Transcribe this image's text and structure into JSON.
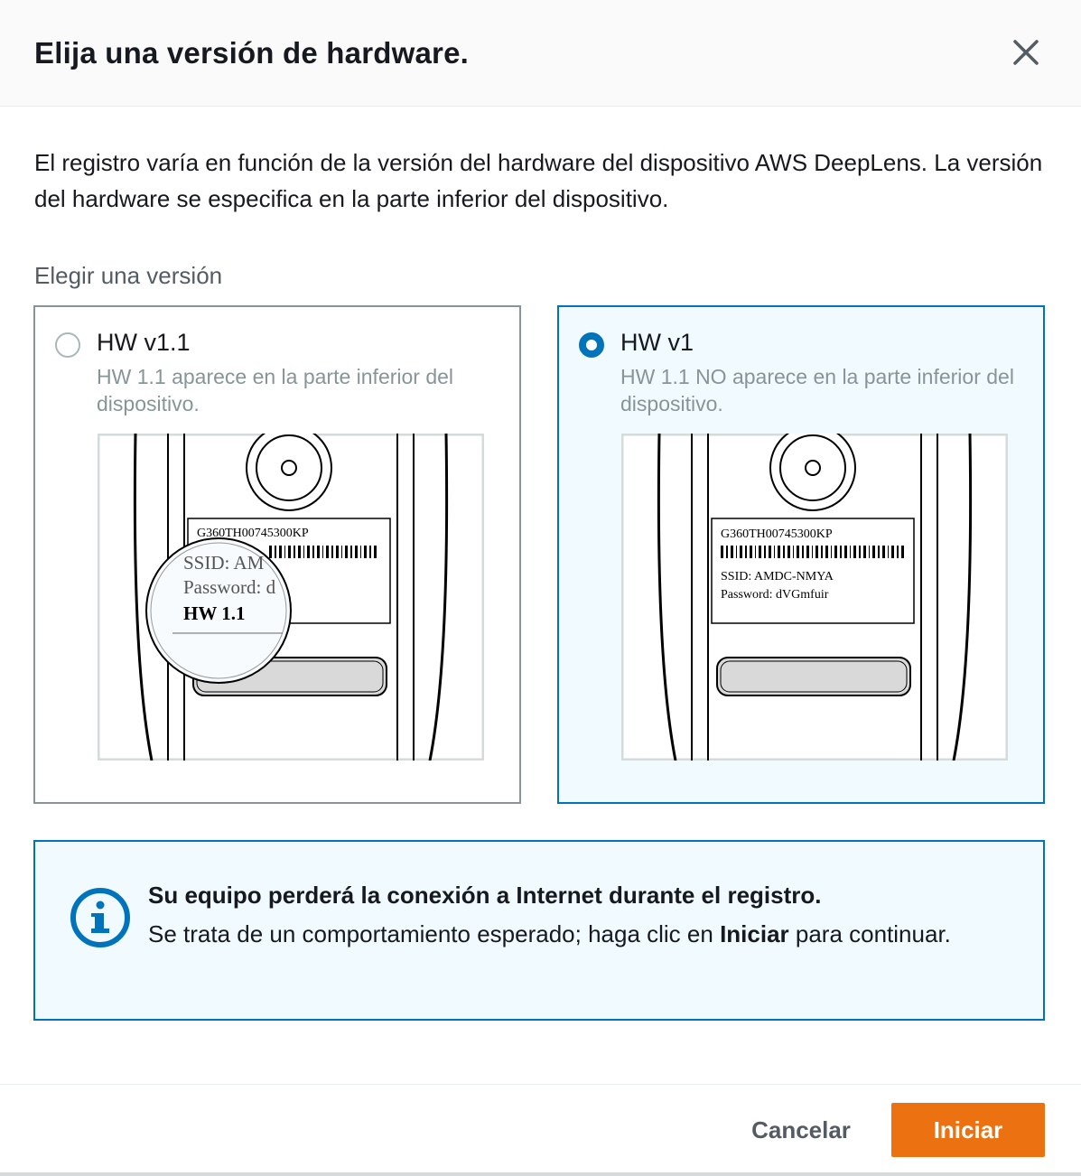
{
  "dialog": {
    "title": "Elija una versión de hardware.",
    "close_icon": "close-icon"
  },
  "description": "El registro varía en función de la versión del hardware del dispositivo AWS DeepLens. La versión del hardware se especifica en la parte inferior del dispositivo.",
  "version_group": {
    "label": "Elegir una versión",
    "selected": "HW v1",
    "options": [
      {
        "title": "HW v1.1",
        "description": "HW 1.1 aparece en la parte inferior del dispositivo.",
        "selected": false,
        "label_serial": "G360TH00745300KP",
        "label_ssid": "SSID: AM",
        "label_password": "Password: d",
        "label_hw": "HW 1.1"
      },
      {
        "title": "HW v1",
        "description": "HW 1.1 NO aparece en la parte inferior del dispositivo.",
        "selected": true,
        "label_serial": "G360TH00745300KP",
        "label_ssid": "SSID: AMDC-NMYA",
        "label_password": "Password: dVGmfuir"
      }
    ]
  },
  "alert": {
    "icon": "info-icon",
    "heading": "Su equipo perderá la conexión a Internet durante el registro.",
    "body_before": "Se trata de un comportamiento esperado; haga clic en ",
    "body_bold": "Iniciar",
    "body_after": " para continuar."
  },
  "footer": {
    "cancel_label": "Cancelar",
    "start_label": "Iniciar"
  },
  "colors": {
    "accent": "#0073bb",
    "primary_button": "#ec7211",
    "selected_tile_bg": "#f1faff"
  }
}
